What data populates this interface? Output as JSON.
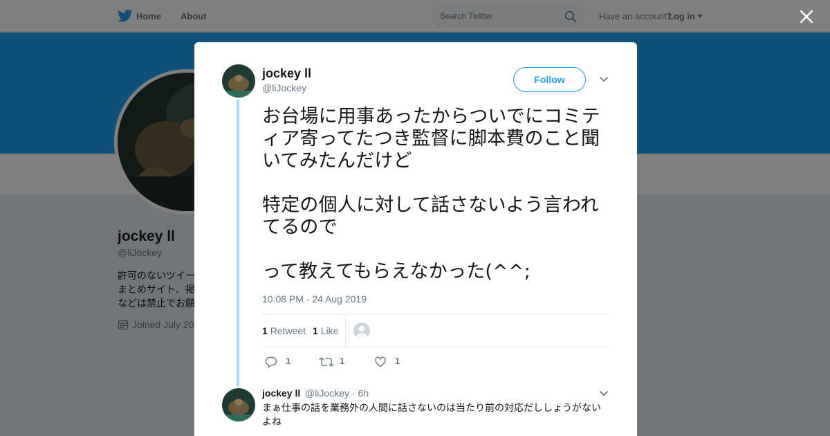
{
  "nav": {
    "home_label": "Home",
    "about_label": "About",
    "search_placeholder": "Search Twitter",
    "have_account": "Have an account?",
    "login_label": "Log in"
  },
  "profile": {
    "name": "jockey ll",
    "handle": "@liJockey",
    "bio_lines": [
      "許可のないツイー",
      "まとめサイト、掲",
      "などは禁止でお願"
    ],
    "joined": "Joined July 20"
  },
  "tweet": {
    "author_name": "jockey ll",
    "author_handle": "@liJockey",
    "follow_label": "Follow",
    "text": "お台場に用事あったからついでにコミティア寄ってたつき監督に脚本費のこと聞いてみたんだけど\n\n特定の個人に対して話さないよう言われてるので\n\nって教えてもらえなかった(^^;",
    "timestamp": "10:08 PM - 24 Aug 2019",
    "retweet_count": "1",
    "retweet_label": "Retweet",
    "like_count": "1",
    "like_label": "Like",
    "reply_action_count": "1",
    "retweet_action_count": "1",
    "like_action_count": "1"
  },
  "reply": {
    "author_name": "jockey ll",
    "author_handle": "@liJockey",
    "time": "· 6h",
    "text": "まぁ仕事の話を業務外の人間に話さないのは当たり前の対応だししょうがないよね"
  },
  "colors": {
    "brand_blue": "#1da1f2",
    "thread_line": "#a5d8f8",
    "secondary_text": "#657786"
  },
  "icons": [
    "twitter-bird-icon",
    "search-icon",
    "caret-down-icon",
    "close-icon",
    "chevron-down-icon",
    "calendar-icon",
    "reply-icon",
    "retweet-icon",
    "heart-icon"
  ]
}
